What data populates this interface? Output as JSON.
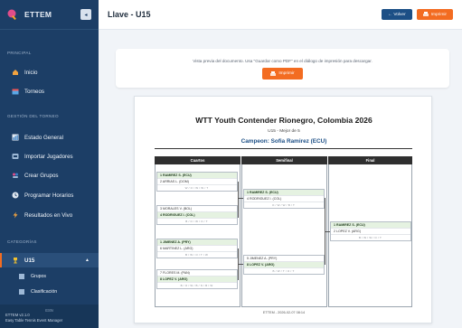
{
  "app": {
    "name": "ETTEM",
    "collapse_icon": "◂",
    "brand_color": "#1c3e66",
    "accent_color": "#f36c21"
  },
  "sidebar": {
    "sections": [
      {
        "title": "PRINCIPAL"
      },
      {
        "title": "GESTIÓN DEL TORNEO"
      },
      {
        "title": "CATEGORÍAS"
      }
    ],
    "items": [
      {
        "label": "Inicio",
        "icon": "home-icon"
      },
      {
        "label": "Torneos",
        "icon": "calendar-icon"
      },
      {
        "label": "Estado General",
        "icon": "chart-icon"
      },
      {
        "label": "Importar Jugadores",
        "icon": "import-icon"
      },
      {
        "label": "Crear Grupos",
        "icon": "users-icon"
      },
      {
        "label": "Programar Horarios",
        "icon": "clock-icon"
      },
      {
        "label": "Resultados en Vivo",
        "icon": "bolt-icon"
      }
    ],
    "category": {
      "label": "U15",
      "icon": "trophy-icon",
      "caret": "▲"
    },
    "sub_items": [
      {
        "label": "Grupos"
      },
      {
        "label": "Clasificación"
      }
    ],
    "footer": {
      "lang": "ESN",
      "version": "ETTEM v2.1.0",
      "tagline": "Easy Table Tennis Event Manager"
    }
  },
  "header": {
    "title": "Llave - U15",
    "back_label": "← Volver",
    "print_label": "Imprimir"
  },
  "info": {
    "text": "Vista previa del documento. Usa \"Guardar como PDF\" en el diálogo de impresión para descargar.",
    "print_label": "Imprimir"
  },
  "document": {
    "title": "WTT Youth Contender Rionegro, Colombia 2026",
    "subtitle": "U15 - Mejor de 5",
    "champion": "Campeon: Sofia Ramirez (ECU)",
    "rounds": [
      "Cuartos",
      "Semifinal",
      "Final"
    ],
    "cuartos": [
      {
        "p1": "1 RAMIREZ S. (ECU)",
        "p2": "2 ARRIAS L. (DOM)",
        "score": "W/O/W/W/T",
        "winner": 1
      },
      {
        "p1": "3 MORALES V. (BOL)",
        "p2": "4 RODRIGUEZ I. (COL)",
        "score": "B/O/W/O/T",
        "winner": 2
      },
      {
        "p1": "1 JIMENEZ A. (PRY)",
        "p2": "6 MARTINEZ L. (ARG)",
        "score": "B/W/O/T/W",
        "winner": 1
      },
      {
        "p1": "7 FLORES M. (PAN)",
        "p2": "8 LOPEZ V. (ARG)",
        "score": "B/O/W/B/N/B/W",
        "winner": 2
      }
    ],
    "semis": [
      {
        "p1": "1 RAMIREZ S. (ECU)",
        "p2": "4 RODRIGUEZ I. (COL)",
        "score": "O/W/W/B/T",
        "winner": 1
      },
      {
        "p1": "5 JIMENEZ A. (PRY)",
        "p2": "8 LOPEZ V. (ARG)",
        "score": "B/W/T/O/T",
        "winner": 2
      }
    ],
    "final": {
      "p1": "1 RAMIREZ S. (ECU)",
      "p2": "2 LOPEZ V. (ARG)",
      "score": "B/W/W/O/T",
      "winner": 1
    },
    "footer": "ETTEM - 2026-02-07 08:14"
  }
}
